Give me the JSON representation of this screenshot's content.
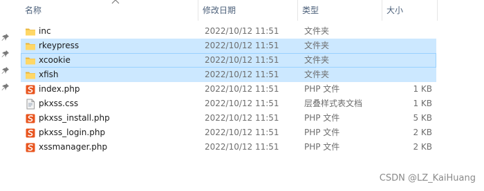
{
  "columns": {
    "name": "名称",
    "modified": "修改日期",
    "type": "类型",
    "size": "大小"
  },
  "files": [
    {
      "name": "inc",
      "modified": "2022/10/12 11:51",
      "type": "文件夹",
      "size": "",
      "icon": "folder-icon"
    },
    {
      "name": "rkeypress",
      "modified": "2022/10/12 11:51",
      "type": "文件夹",
      "size": "",
      "icon": "folder-icon"
    },
    {
      "name": "xcookie",
      "modified": "2022/10/12 11:51",
      "type": "文件夹",
      "size": "",
      "icon": "folder-icon"
    },
    {
      "name": "xfish",
      "modified": "2022/10/12 11:51",
      "type": "文件夹",
      "size": "",
      "icon": "folder-icon"
    },
    {
      "name": "index.php",
      "modified": "2022/10/12 11:51",
      "type": "PHP 文件",
      "size": "1 KB",
      "icon": "php-file-icon"
    },
    {
      "name": "pkxss.css",
      "modified": "2022/10/12 11:51",
      "type": "层叠样式表文档",
      "size": "1 KB",
      "icon": "css-file-icon"
    },
    {
      "name": "pkxss_install.php",
      "modified": "2022/10/12 11:51",
      "type": "PHP 文件",
      "size": "5 KB",
      "icon": "php-file-icon"
    },
    {
      "name": "pkxss_login.php",
      "modified": "2022/10/12 11:51",
      "type": "PHP 文件",
      "size": "2 KB",
      "icon": "php-file-icon"
    },
    {
      "name": "xssmanager.php",
      "modified": "2022/10/12 11:51",
      "type": "PHP 文件",
      "size": "2 KB",
      "icon": "php-file-icon"
    }
  ],
  "watermark": "CSDN @LZ_KaiHuang",
  "colors": {
    "selection": "#cce8ff",
    "focus_border": "#99d1ff",
    "folder": "#ffd766",
    "php_icon": "#e8541e"
  }
}
